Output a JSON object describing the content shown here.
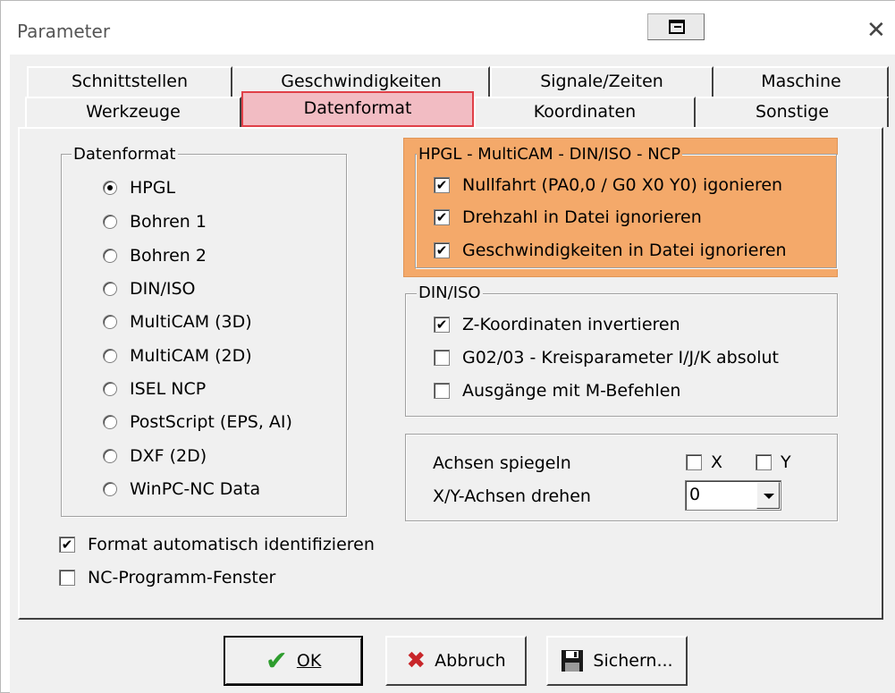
{
  "window": {
    "title": "Parameter"
  },
  "tabs_row1": [
    "Schnittstellen",
    "Geschwindigkeiten",
    "Signale/Zeiten",
    "Maschine"
  ],
  "tabs_row2": [
    "Werkzeuge",
    "Datenformat",
    "Koordinaten",
    "Sonstige"
  ],
  "selected_tab": "Datenformat",
  "datenformat_group": {
    "title": "Datenformat",
    "options": [
      "HPGL",
      "Bohren 1",
      "Bohren 2",
      "DIN/ISO",
      "MultiCAM (3D)",
      "MultiCAM (2D)",
      "ISEL NCP",
      "PostScript (EPS, AI)",
      "DXF (2D)",
      "WinPC-NC Data"
    ],
    "selected": "HPGL"
  },
  "left_checks": [
    {
      "label": "Format automatisch identifizieren",
      "checked": true
    },
    {
      "label": "NC-Programm-Fenster",
      "checked": false
    }
  ],
  "hpgl_group": {
    "title": "HPGL - MultiCAM - DIN/ISO - NCP",
    "highlight_color": "#f4a96a",
    "items": [
      {
        "label": "Nullfahrt (PA0,0 / G0 X0 Y0) igonieren",
        "checked": true
      },
      {
        "label": "Drehzahl in Datei ignorieren",
        "checked": true
      },
      {
        "label": "Geschwindigkeiten in Datei ignorieren",
        "checked": true
      }
    ]
  },
  "diniso_group": {
    "title": "DIN/ISO",
    "items": [
      {
        "label": "Z-Koordinaten invertieren",
        "checked": true
      },
      {
        "label": "G02/03 - Kreisparameter I/J/K absolut",
        "checked": false
      },
      {
        "label": "Ausgänge mit M-Befehlen",
        "checked": false
      }
    ]
  },
  "axes_group": {
    "mirror_label": "Achsen spiegeln",
    "mirror_x": "X",
    "mirror_y": "Y",
    "rotate_label": "X/Y-Achsen drehen",
    "rotate_value": "0"
  },
  "buttons": {
    "ok_label": "OK",
    "cancel_label": "Abbruch",
    "save_label": "Sichern..."
  },
  "colors": {
    "selected_tab_bg": "#f2bcc3",
    "selected_tab_border": "#e04048",
    "ok_check": "#2e9d2e",
    "cancel_x": "#c8262a"
  },
  "icons": {
    "check_mark": "✔",
    "cancel_mark": "✖",
    "close": "✕"
  }
}
